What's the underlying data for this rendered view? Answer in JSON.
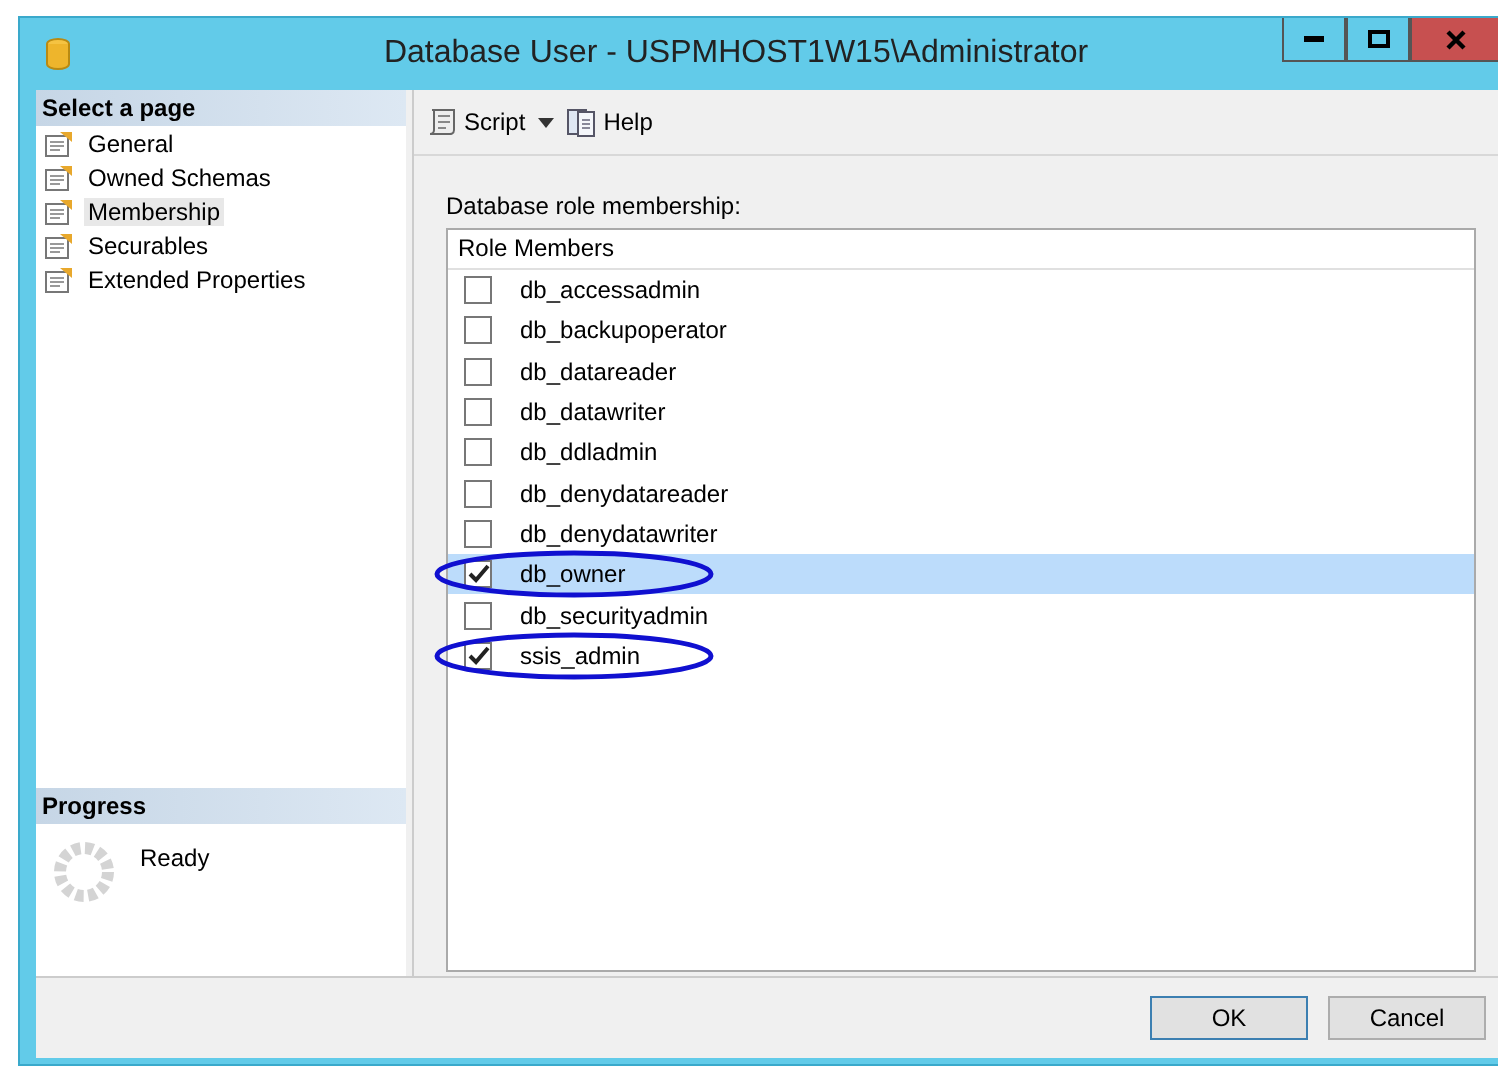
{
  "window": {
    "title": "Database User - USPMHOST1W15\\Administrator"
  },
  "sidebar": {
    "header": "Select a page",
    "items": [
      {
        "label": "General",
        "selected": false
      },
      {
        "label": "Owned Schemas",
        "selected": false
      },
      {
        "label": "Membership",
        "selected": true
      },
      {
        "label": "Securables",
        "selected": false
      },
      {
        "label": "Extended Properties",
        "selected": false
      }
    ]
  },
  "progress": {
    "header": "Progress",
    "status": "Ready"
  },
  "toolbar": {
    "script": "Script",
    "help": "Help"
  },
  "role_membership": {
    "label": "Database role membership:",
    "column": "Role Members",
    "roles": [
      {
        "name": "db_accessadmin",
        "checked": false,
        "selected": false,
        "circled": false
      },
      {
        "name": "db_backupoperator",
        "checked": false,
        "selected": false,
        "circled": false
      },
      {
        "name": "db_datareader",
        "checked": false,
        "selected": false,
        "circled": false
      },
      {
        "name": "db_datawriter",
        "checked": false,
        "selected": false,
        "circled": false
      },
      {
        "name": "db_ddladmin",
        "checked": false,
        "selected": false,
        "circled": false
      },
      {
        "name": "db_denydatareader",
        "checked": false,
        "selected": false,
        "circled": false
      },
      {
        "name": "db_denydatawriter",
        "checked": false,
        "selected": false,
        "circled": false
      },
      {
        "name": "db_owner",
        "checked": true,
        "selected": true,
        "circled": true
      },
      {
        "name": "db_securityadmin",
        "checked": false,
        "selected": false,
        "circled": false
      },
      {
        "name": "ssis_admin",
        "checked": true,
        "selected": false,
        "circled": true
      }
    ]
  },
  "buttons": [
    "OK",
    "Cancel"
  ]
}
